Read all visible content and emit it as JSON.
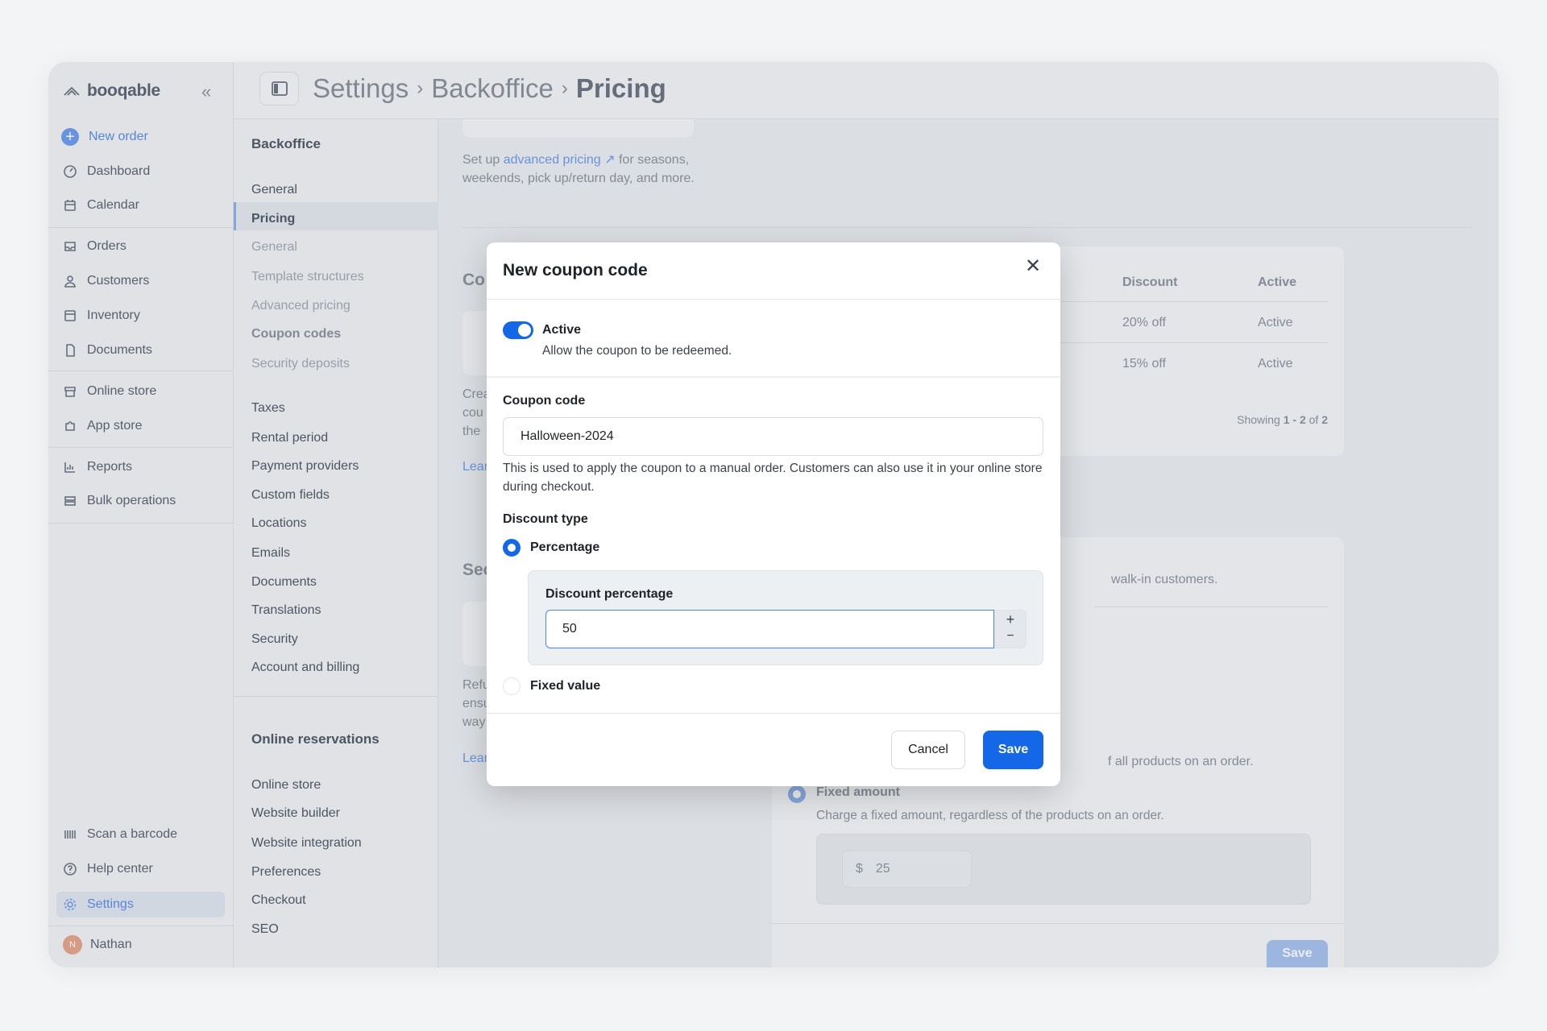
{
  "brand": "booqable",
  "sidebar": {
    "new_order": "New order",
    "items": [
      {
        "label": "Dashboard",
        "icon": "dashboard-icon"
      },
      {
        "label": "Calendar",
        "icon": "calendar-icon"
      },
      {
        "label": "Orders",
        "icon": "orders-icon"
      },
      {
        "label": "Customers",
        "icon": "user-icon"
      },
      {
        "label": "Inventory",
        "icon": "inventory-icon"
      },
      {
        "label": "Documents",
        "icon": "document-icon"
      },
      {
        "label": "Online store",
        "icon": "store-icon"
      },
      {
        "label": "App store",
        "icon": "puzzle-icon"
      },
      {
        "label": "Reports",
        "icon": "reports-icon"
      },
      {
        "label": "Bulk operations",
        "icon": "bulk-icon"
      }
    ],
    "bottom": [
      {
        "label": "Scan a barcode",
        "icon": "barcode-icon"
      },
      {
        "label": "Help center",
        "icon": "help-icon"
      },
      {
        "label": "Settings",
        "icon": "gear-icon",
        "active": true
      }
    ],
    "user": {
      "name": "Nathan",
      "initial": "N"
    }
  },
  "breadcrumb": [
    "Settings",
    "Backoffice",
    "Pricing"
  ],
  "submenu": {
    "backoffice_title": "Backoffice",
    "backoffice": [
      {
        "label": "General"
      },
      {
        "label": "Pricing",
        "active": true
      },
      {
        "label": "General",
        "sub": true
      },
      {
        "label": "Template structures",
        "sub": true
      },
      {
        "label": "Advanced pricing",
        "sub": true
      },
      {
        "label": "Coupon codes",
        "sub": true,
        "current": true
      },
      {
        "label": "Security deposits",
        "sub": true
      },
      {
        "label": "Taxes"
      },
      {
        "label": "Rental period"
      },
      {
        "label": "Payment providers"
      },
      {
        "label": "Custom fields"
      },
      {
        "label": "Locations"
      },
      {
        "label": "Emails"
      },
      {
        "label": "Documents"
      },
      {
        "label": "Translations"
      },
      {
        "label": "Security"
      },
      {
        "label": "Account and billing"
      }
    ],
    "online_title": "Online reservations",
    "online": [
      {
        "label": "Online store"
      },
      {
        "label": "Website builder"
      },
      {
        "label": "Website integration"
      },
      {
        "label": "Preferences"
      },
      {
        "label": "Checkout"
      },
      {
        "label": "SEO"
      }
    ]
  },
  "main": {
    "adv_prefix": "Set up ",
    "adv_link": "advanced pricing",
    "adv_suffix": " for seasons,",
    "adv_line2": "weekends, pick up/return day, and more.",
    "coupon_heading_partial": "Co",
    "coupon_desc_partial": [
      "Crea",
      "cou",
      "the"
    ],
    "learn_partial": "Lear",
    "table": {
      "headers": [
        "Discount",
        "Active"
      ],
      "rows": [
        [
          "20% off",
          "Active"
        ],
        [
          "15% off",
          "Active"
        ]
      ],
      "showing_prefix": "Showing ",
      "showing_range": "1 - 2",
      "showing_of": " of ",
      "showing_total": "2"
    },
    "security_heading_partial": "Sec",
    "security_desc_partial": [
      "Refu",
      "ensu",
      "way"
    ],
    "walkin_partial": "walk-in customers.",
    "percent_partial": "f all products on an order.",
    "fixed_amount_label": "Fixed amount",
    "fixed_amount_desc": "Charge a fixed amount, regardless of the products on an order.",
    "currency": "$",
    "fixed_amount_value": "25",
    "save": "Save"
  },
  "modal": {
    "title": "New coupon code",
    "active_label": "Active",
    "active_on": true,
    "active_desc": "Allow the coupon to be redeemed.",
    "code_label": "Coupon code",
    "code_value": "Halloween-2024",
    "code_help": "This is used to apply the coupon to a manual order. Customers can also use it in your online store during checkout.",
    "discount_type_label": "Discount type",
    "options": [
      "Percentage",
      "Fixed value"
    ],
    "selected": "Percentage",
    "percentage_label": "Discount percentage",
    "percentage_value": "50",
    "plus": "+",
    "minus": "−",
    "cancel": "Cancel",
    "save": "Save"
  },
  "colors": {
    "accent": "#1467e6",
    "bg": "#f3f4f5"
  }
}
